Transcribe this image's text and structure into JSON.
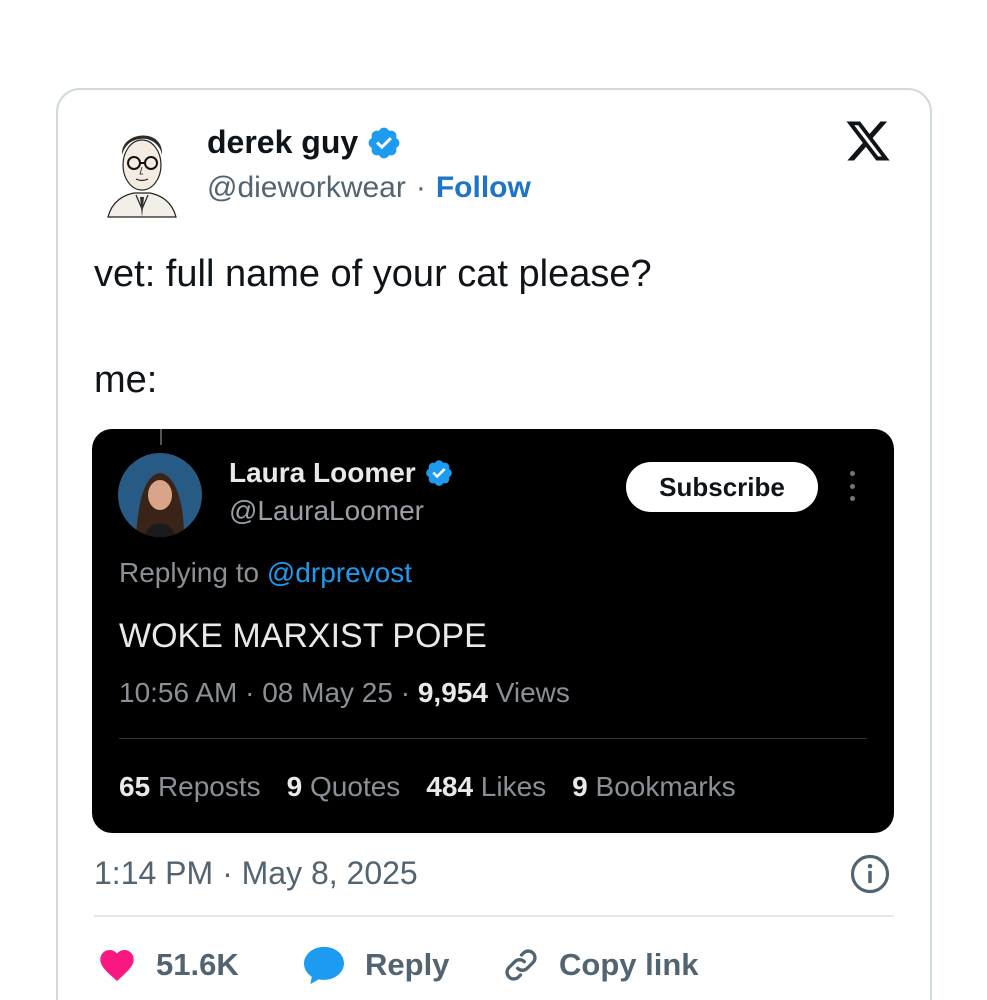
{
  "author": {
    "name": "derek guy",
    "handle": "@dieworkwear",
    "separator": "·",
    "follow_label": "Follow",
    "verified_color": "#1d9bf0"
  },
  "tweet": {
    "line1": "vet: full name of your cat please?",
    "line2": "me:"
  },
  "quoted": {
    "name": "Laura Loomer",
    "handle": "@LauraLoomer",
    "subscribe_label": "Subscribe",
    "replying_prefix": "Replying to",
    "replying_to": "@drprevost",
    "text": "WOKE MARXIST POPE",
    "time": "10:56 AM",
    "date": "08 May 25",
    "views_count": "9,954",
    "views_label": "Views",
    "stats": [
      {
        "count": "65",
        "label": "Reposts"
      },
      {
        "count": "9",
        "label": "Quotes"
      },
      {
        "count": "484",
        "label": "Likes"
      },
      {
        "count": "9",
        "label": "Bookmarks"
      }
    ]
  },
  "timestamp": "1:14 PM · May 8, 2025",
  "actions": {
    "likes": "51.6K",
    "reply_label": "Reply",
    "copy_label": "Copy link",
    "like_color": "#f91880",
    "reply_color": "#1d9bf0"
  },
  "icons": [
    "x-logo-icon",
    "verified-badge-icon",
    "info-icon",
    "heart-icon",
    "reply-bubble-icon",
    "link-icon",
    "more-vertical-icon"
  ]
}
